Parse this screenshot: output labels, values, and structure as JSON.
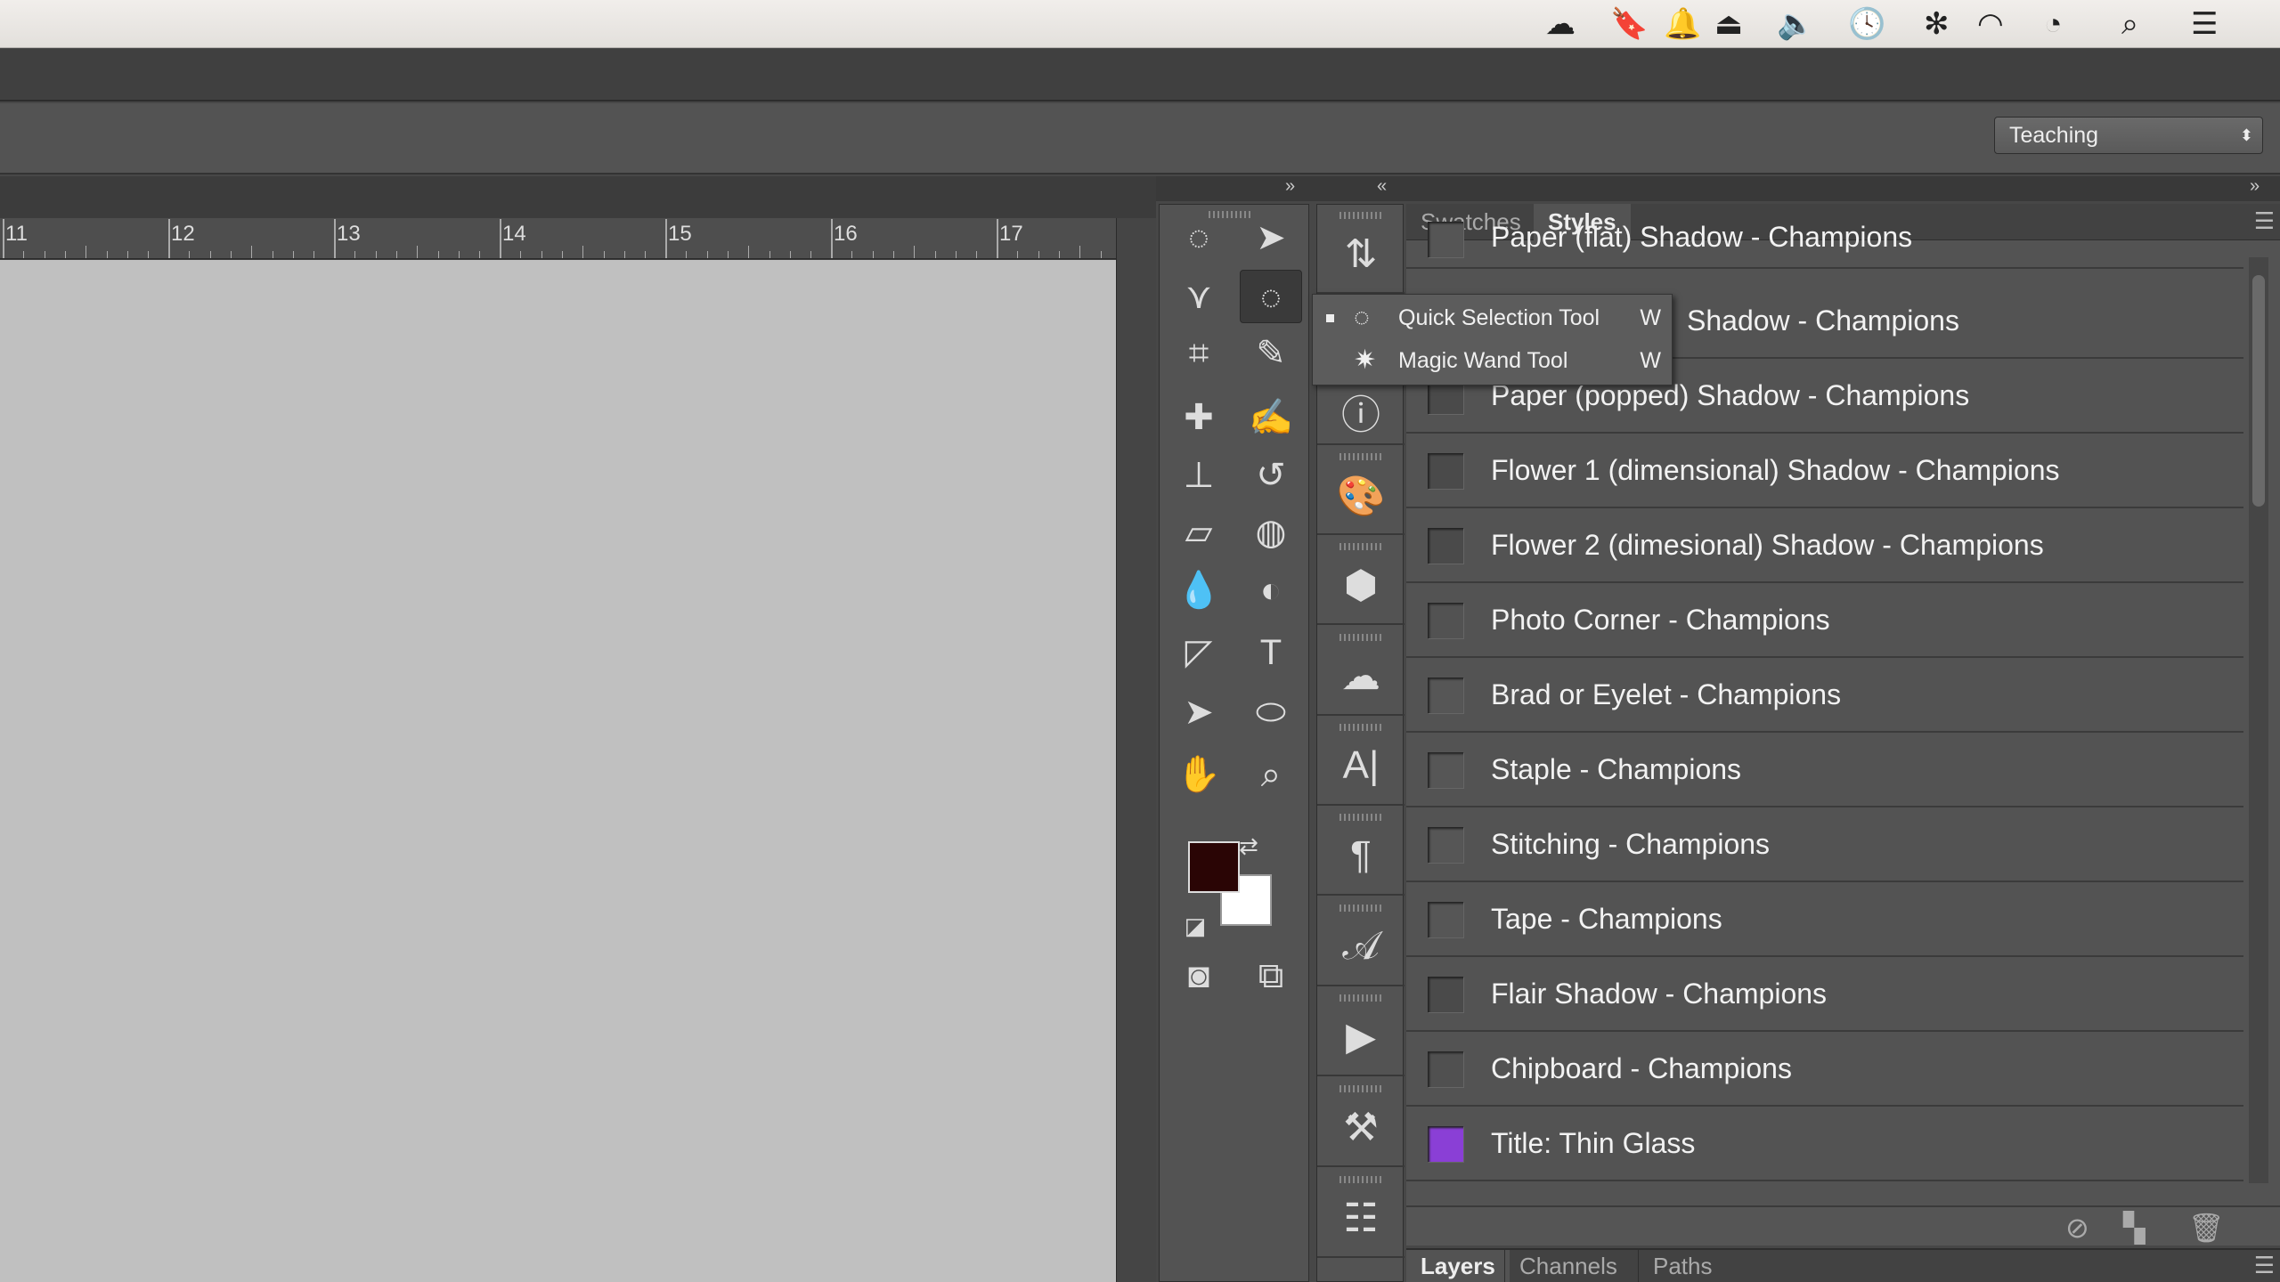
{
  "menubar": {
    "icons": [
      "creative-cloud-icon",
      "bookmark-icon",
      "notification-icon",
      "airplay-icon",
      "volume-icon",
      "time-machine-icon",
      "bluetooth-icon",
      "wifi-icon",
      "clock-icon",
      "spotlight-search-icon",
      "notification-center-icon"
    ]
  },
  "options_bar": {
    "workspace": "Teaching"
  },
  "ruler": {
    "labels": [
      "11",
      "12",
      "13",
      "14",
      "15",
      "16",
      "17"
    ]
  },
  "tool_popup": {
    "items": [
      {
        "label": "Quick Selection Tool",
        "shortcut": "W",
        "selected": true
      },
      {
        "label": "Magic Wand Tool",
        "shortcut": "W",
        "selected": false
      }
    ]
  },
  "styles_panel": {
    "tabs": [
      "Swatches",
      "Styles"
    ],
    "active_tab": "Styles",
    "items": [
      {
        "label": "Paper (flat) Shadow - Champions",
        "color": "#555555"
      },
      {
        "label": "Shadow - Champions",
        "color": "#555555"
      },
      {
        "label": "Paper (popped) Shadow - Champions",
        "color": "#4a4a4a"
      },
      {
        "label": "Flower 1 (dimensional) Shadow - Champions",
        "color": "#4a4a4a"
      },
      {
        "label": "Flower 2 (dimesional) Shadow - Champions",
        "color": "#4a4a4a"
      },
      {
        "label": "Photo Corner - Champions",
        "color": "#525252"
      },
      {
        "label": "Brad or Eyelet - Champions",
        "color": "#565656"
      },
      {
        "label": "Staple - Champions",
        "color": "#565656"
      },
      {
        "label": "Stitching - Champions",
        "color": "#565656"
      },
      {
        "label": "Tape - Champions",
        "color": "#565656"
      },
      {
        "label": "Flair Shadow - Champions",
        "color": "#4a4a4a"
      },
      {
        "label": "Chipboard - Champions",
        "color": "#505050"
      },
      {
        "label": "Title: Thin Glass",
        "color": "#8a3fd6"
      }
    ]
  },
  "bottom_panel": {
    "tabs": [
      "Layers",
      "Channels",
      "Paths"
    ],
    "active_tab": "Layers"
  },
  "colors": {
    "foreground": "#2a0505",
    "background": "#ffffff"
  }
}
